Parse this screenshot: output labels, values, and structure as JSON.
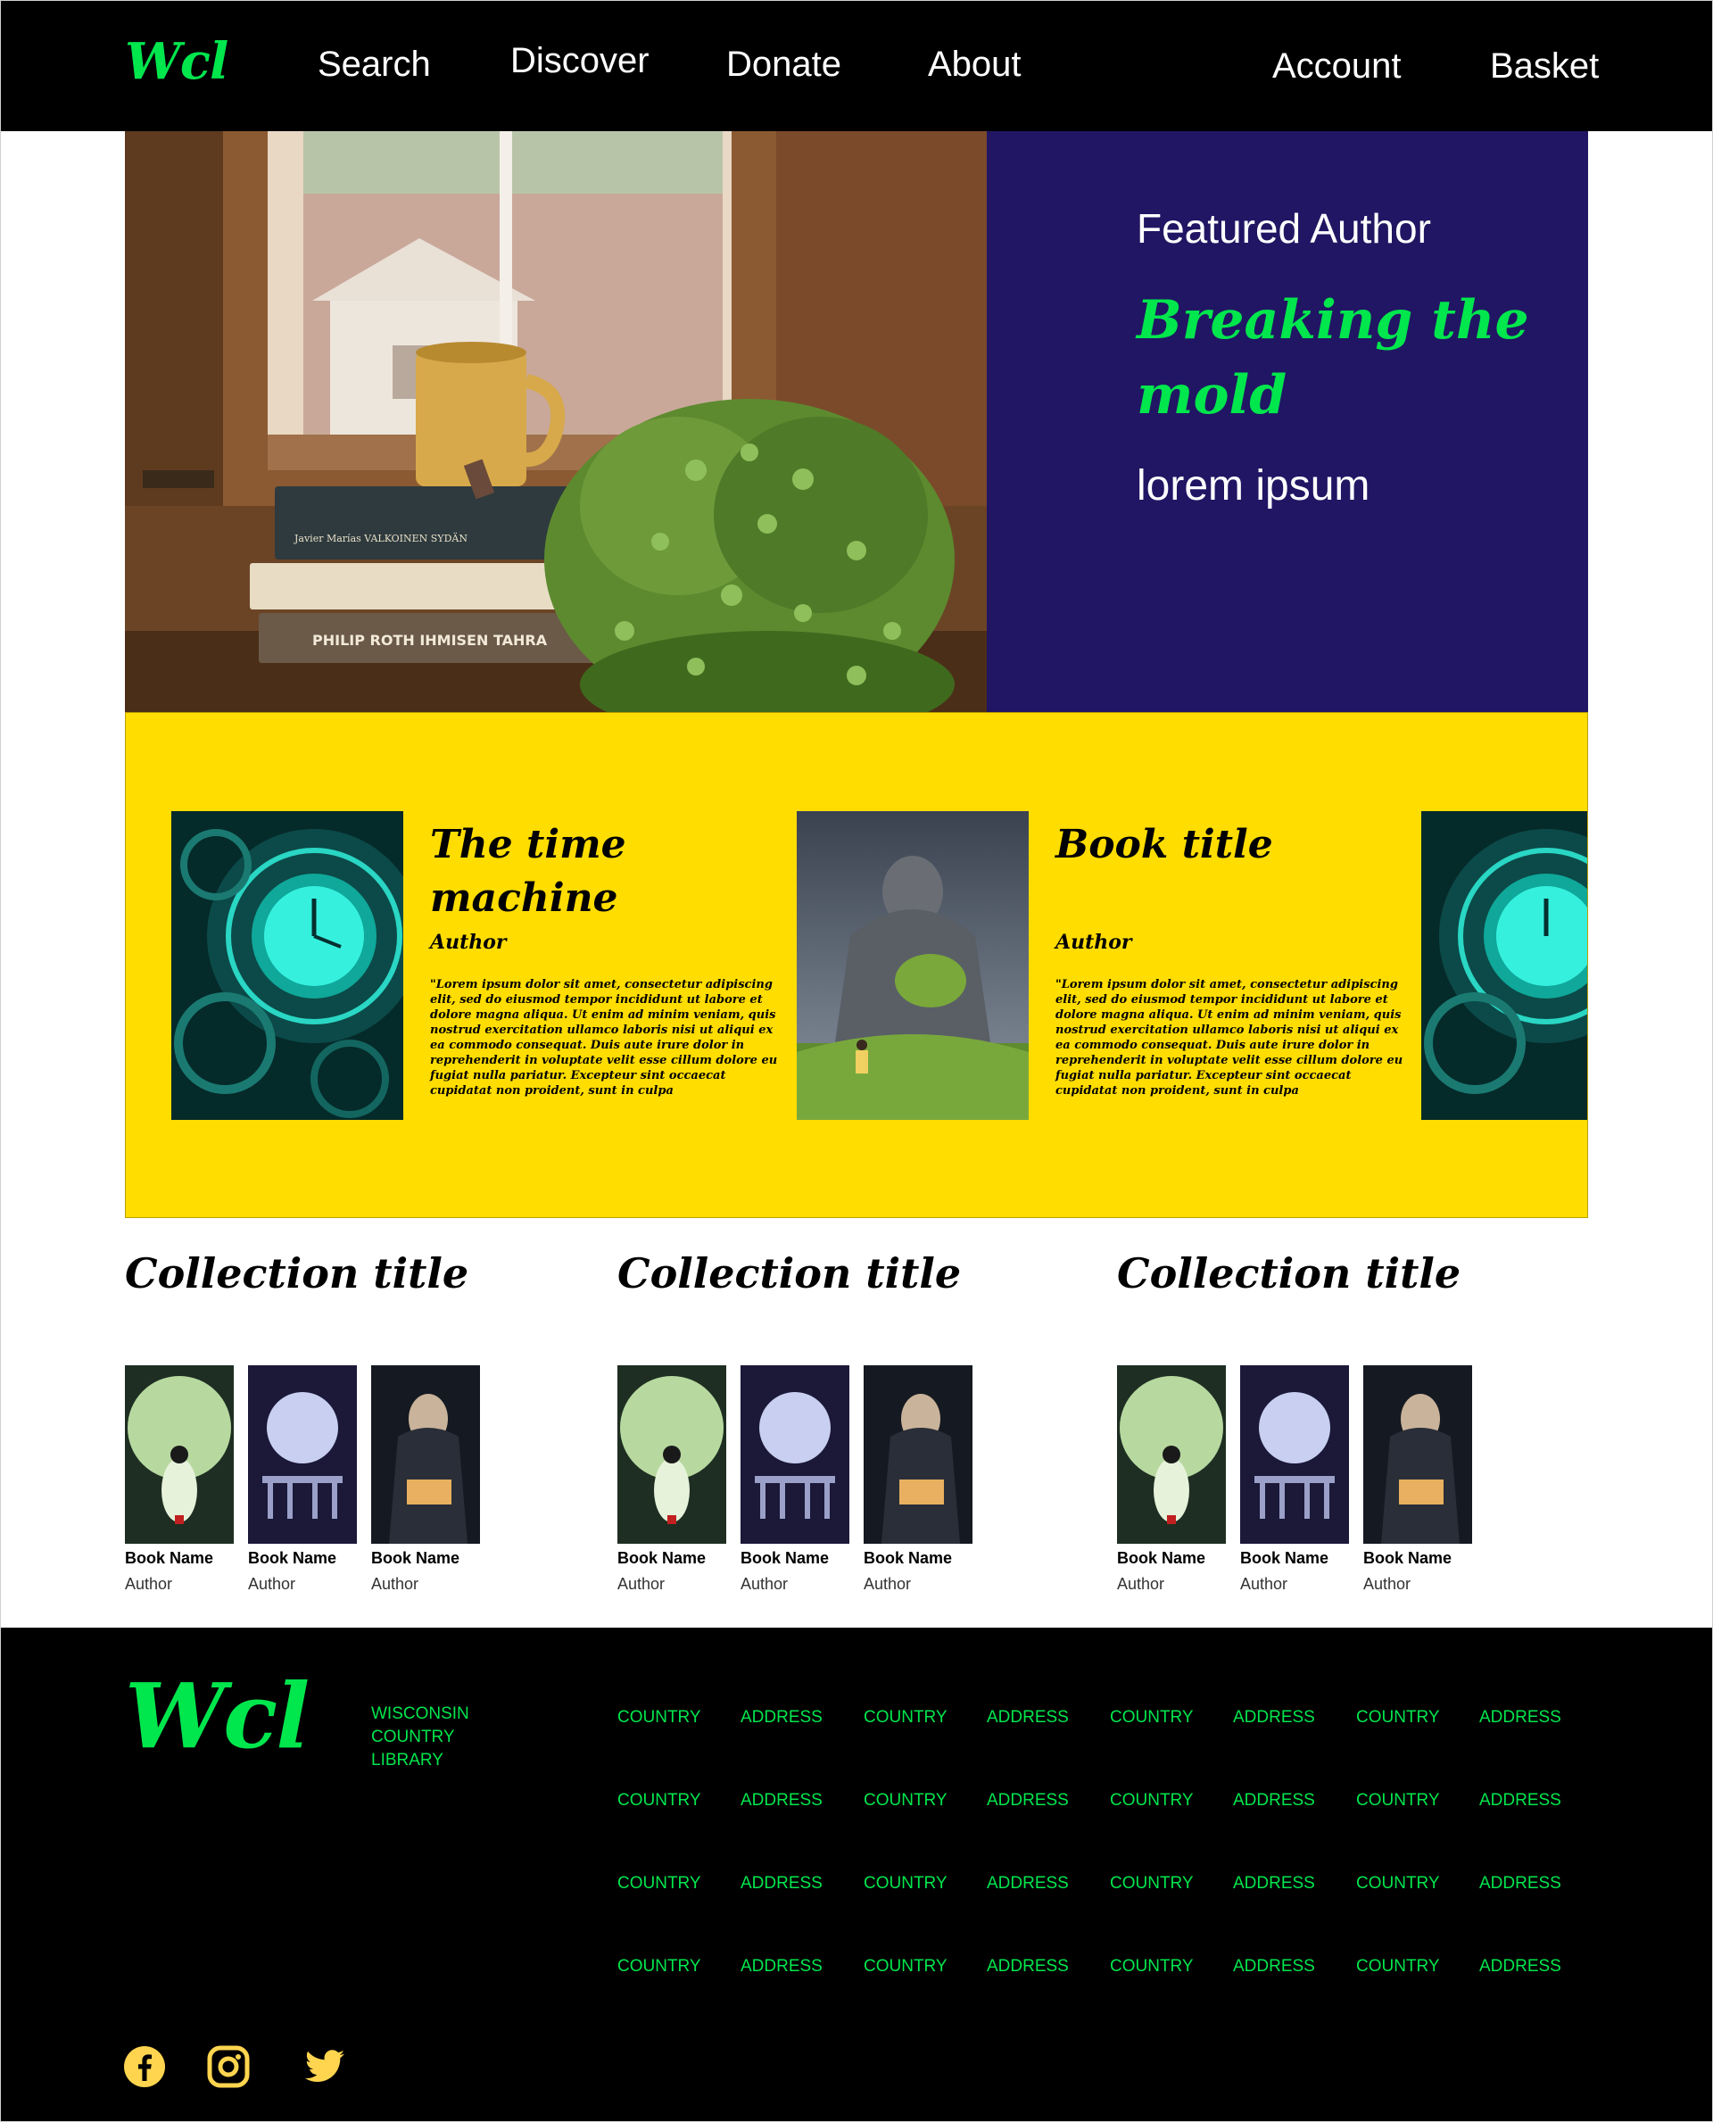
{
  "nav": {
    "logo": "Wcl",
    "items": [
      "Search",
      "Discover",
      "Donate",
      "About"
    ],
    "account": "Account",
    "basket": "Basket"
  },
  "hero": {
    "eyebrow": "Featured Author",
    "headline": "Breaking the mold",
    "subtitle": "lorem ipsum",
    "book_spines": [
      "Javier Marías VALKOINEN SYDÄN",
      "PHILIP ROTH IHMISEN TAHRA"
    ]
  },
  "carousel": {
    "cards": [
      {
        "title": "The time machine",
        "author": "Author",
        "description": "\"Lorem ipsum dolor sit amet, consectetur adipiscing elit, sed do eiusmod tempor incididunt ut labore et dolore magna aliqua. Ut enim ad minim veniam, quis nostrud exercitation ullamco laboris nisi ut aliqui ex ea commodo consequat. Duis aute irure dolor in reprehenderit in voluptate velit esse cillum dolore eu fugiat nulla pariatur. Excepteur sint occaecat cupidatat non proident, sunt in culpa"
      },
      {
        "title": "Book title",
        "author": "Author",
        "description": "\"Lorem ipsum dolor sit amet, consectetur adipiscing elit, sed do eiusmod tempor incididunt ut labore et dolore magna aliqua. Ut enim ad minim veniam, quis nostrud exercitation ullamco laboris nisi ut aliqui ex ea commodo consequat. Duis aute irure dolor in reprehenderit in voluptate velit esse cillum dolore eu fugiat nulla pariatur. Excepteur sint occaecat cupidatat non proident, sunt in culpa"
      }
    ]
  },
  "collections": [
    {
      "title": "Collection title",
      "books": [
        {
          "name": "Book Name",
          "author": "Author"
        },
        {
          "name": "Book Name",
          "author": "Author"
        },
        {
          "name": "Book Name",
          "author": "Author"
        }
      ]
    },
    {
      "title": "Collection title",
      "books": [
        {
          "name": "Book Name",
          "author": "Author"
        },
        {
          "name": "Book Name",
          "author": "Author"
        },
        {
          "name": "Book Name",
          "author": "Author"
        }
      ]
    },
    {
      "title": "Collection title",
      "books": [
        {
          "name": "Book Name",
          "author": "Author"
        },
        {
          "name": "Book Name",
          "author": "Author"
        },
        {
          "name": "Book Name",
          "author": "Author"
        }
      ]
    }
  ],
  "footer": {
    "logo": "Wcl",
    "library_name": "WISCONSIN COUNTRY LIBRARY",
    "grid": [
      [
        "COUNTRY",
        "ADDRESS",
        "COUNTRY",
        "ADDRESS",
        "COUNTRY",
        "ADDRESS",
        "COUNTRY",
        "ADDRESS"
      ],
      [
        "COUNTRY",
        "ADDRESS",
        "COUNTRY",
        "ADDRESS",
        "COUNTRY",
        "ADDRESS",
        "COUNTRY",
        "ADDRESS"
      ],
      [
        "COUNTRY",
        "ADDRESS",
        "COUNTRY",
        "ADDRESS",
        "COUNTRY",
        "ADDRESS",
        "COUNTRY",
        "ADDRESS"
      ],
      [
        "COUNTRY",
        "ADDRESS",
        "COUNTRY",
        "ADDRESS",
        "COUNTRY",
        "ADDRESS",
        "COUNTRY",
        "ADDRESS"
      ]
    ],
    "social_icons": [
      "facebook-icon",
      "instagram-icon",
      "twitter-icon"
    ]
  },
  "colors": {
    "brand_green": "#00e64d",
    "hero_panel": "#211663",
    "carousel_bg": "#ffdd00",
    "social_yellow": "#ffd54f"
  }
}
